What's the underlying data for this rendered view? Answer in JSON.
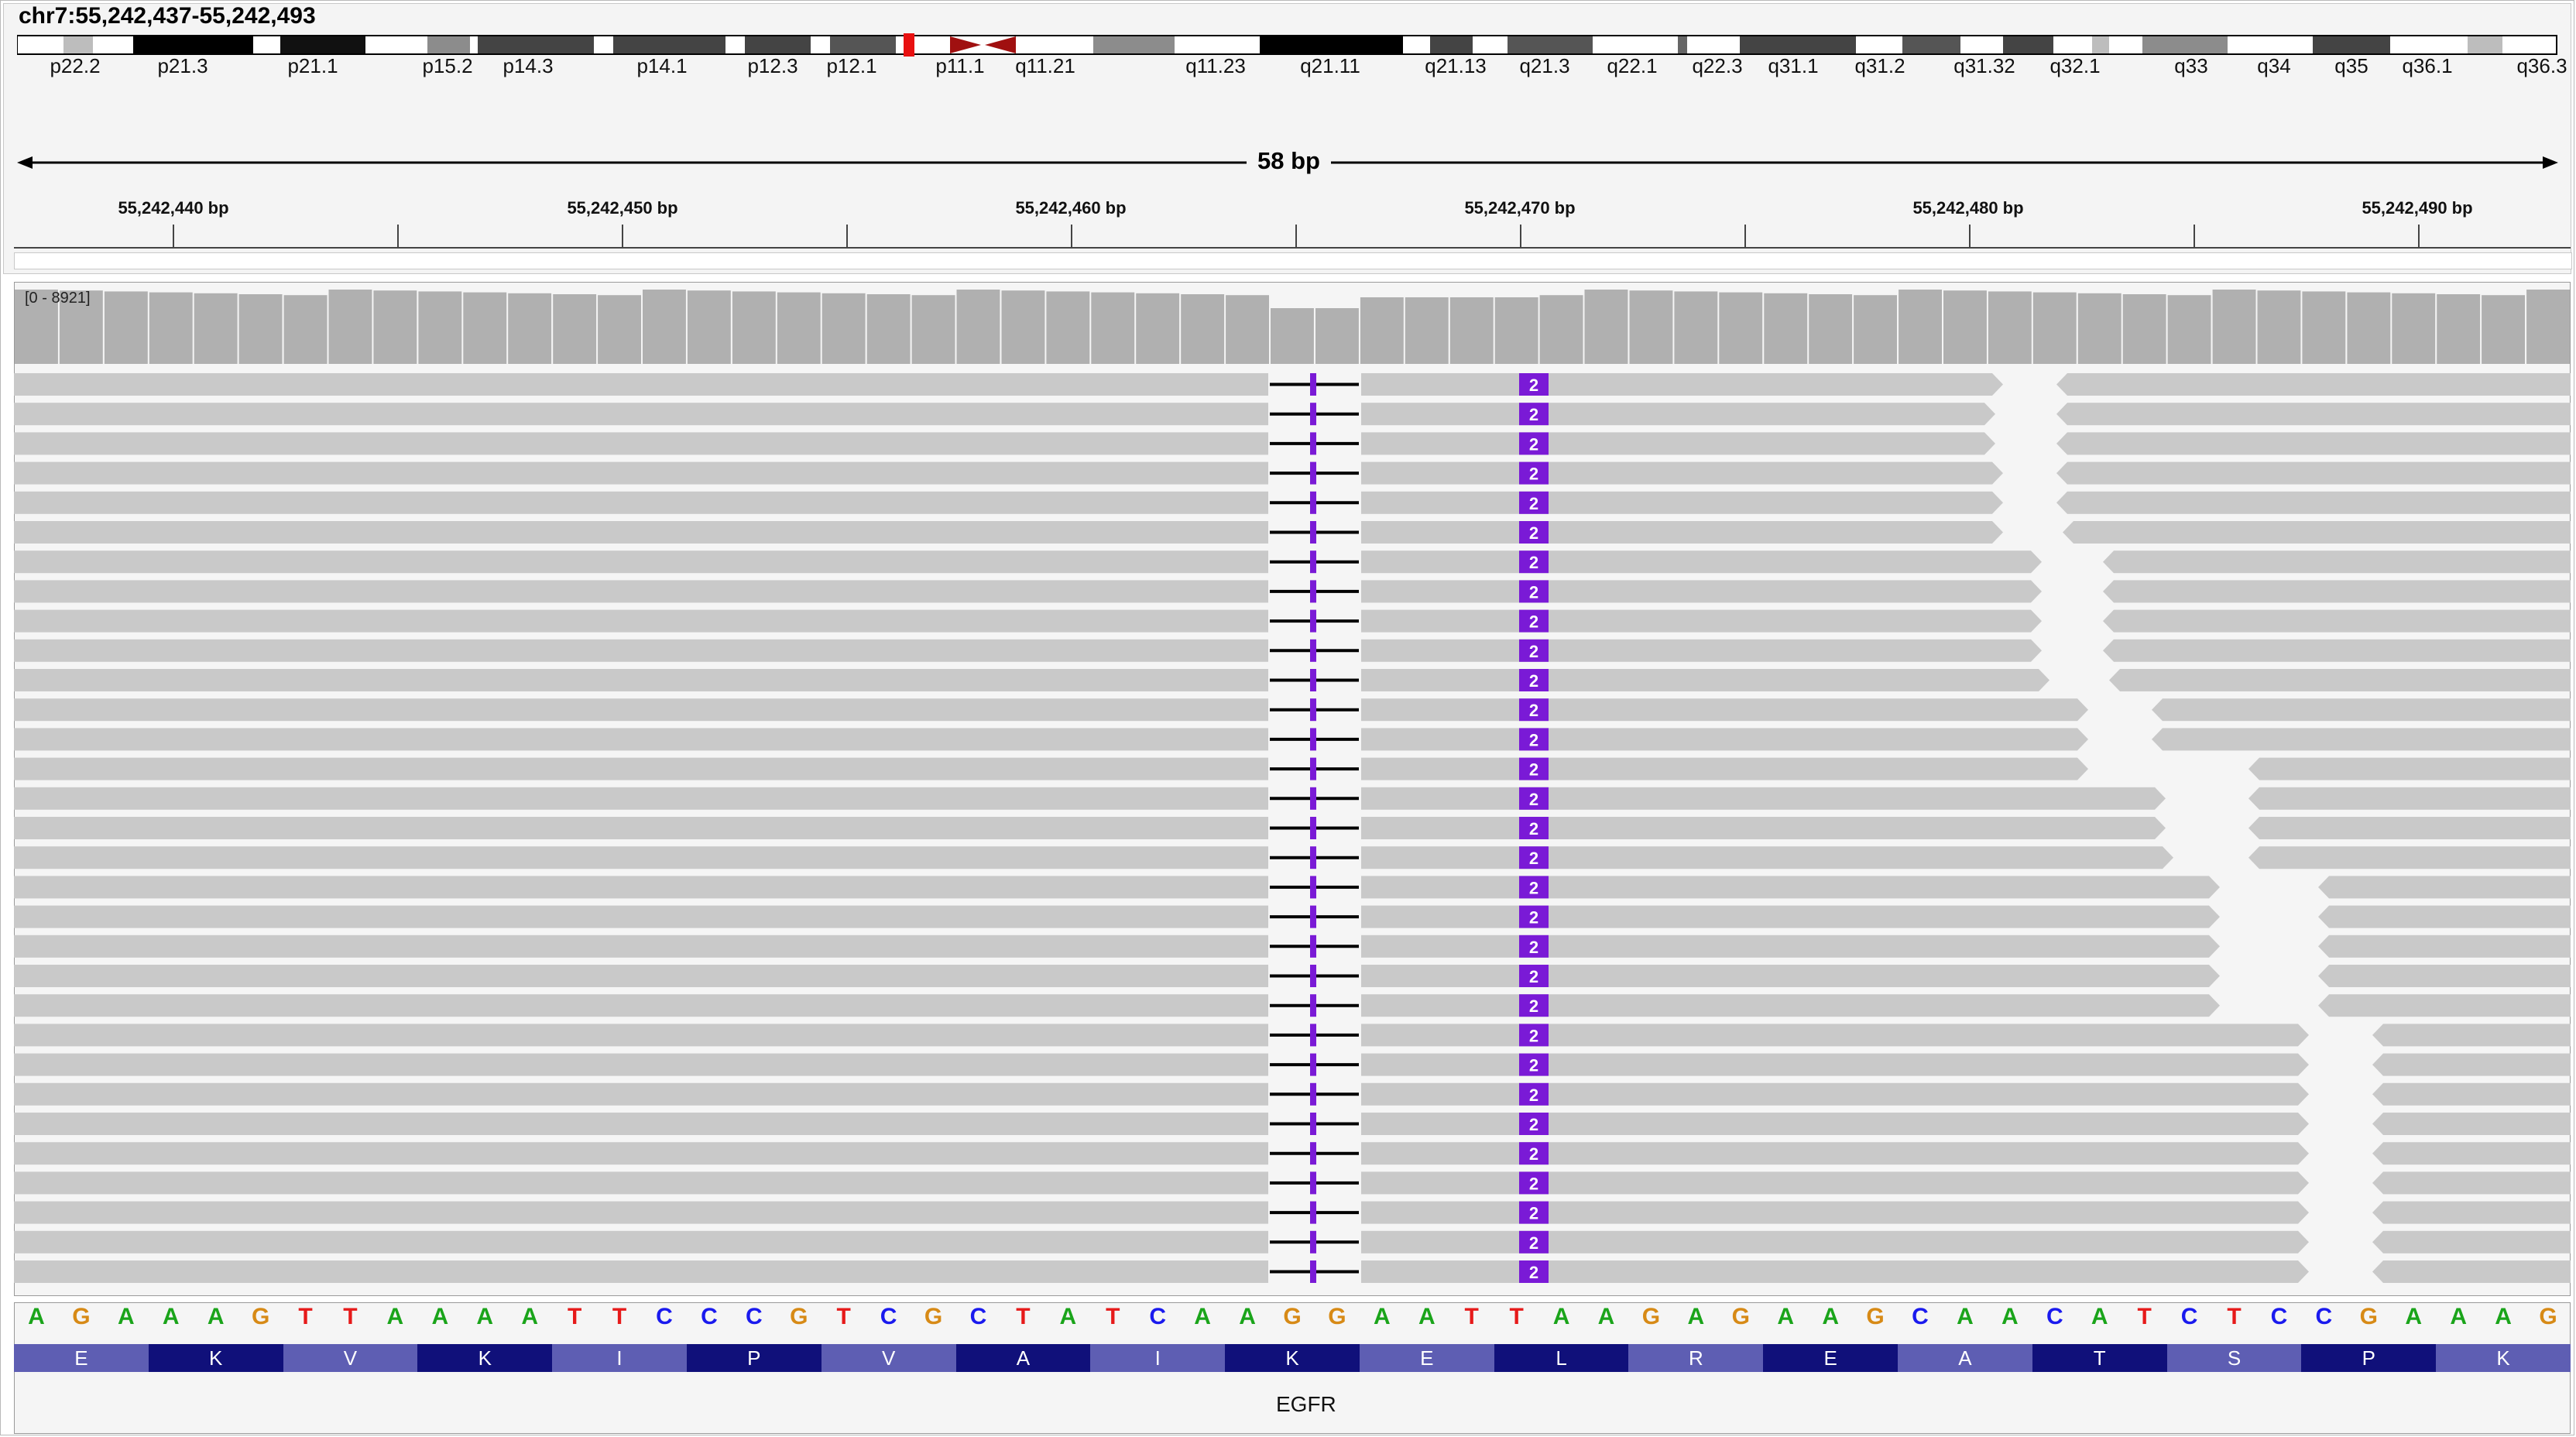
{
  "locus": "chr7:55,242,437-55,242,493",
  "span_label": "58 bp",
  "coverage_range": "[0 - 8921]",
  "gene_name": "EGFR",
  "ideogram_bands": [
    "p22.2",
    "p21.3",
    "p21.1",
    "p15.2",
    "p14.3",
    "p14.1",
    "p12.3",
    "p12.1",
    "p11.1",
    "q11.21",
    "q11.23",
    "q21.11",
    "q21.13",
    "q21.3",
    "q22.1",
    "q22.3",
    "q31.1",
    "q31.2",
    "q31.32",
    "q32.1",
    "q33",
    "q34",
    "q35",
    "q36.1",
    "q36.3"
  ],
  "ruler_labels": [
    "55,242,440 bp",
    "55,242,450 bp",
    "55,242,460 bp",
    "55,242,470 bp",
    "55,242,480 bp",
    "55,242,490 bp"
  ],
  "sequence": [
    "A",
    "G",
    "A",
    "A",
    "A",
    "G",
    "T",
    "T",
    "A",
    "A",
    "A",
    "A",
    "T",
    "T",
    "C",
    "C",
    "C",
    "G",
    "T",
    "C",
    "G",
    "C",
    "T",
    "A",
    "T",
    "C",
    "A",
    "A",
    "G",
    "G",
    "A",
    "A",
    "T",
    "T",
    "A",
    "A",
    "G",
    "A",
    "G",
    "A",
    "A",
    "G",
    "C",
    "A",
    "A",
    "C",
    "A",
    "T",
    "C",
    "T",
    "C",
    "C",
    "G",
    "A",
    "A",
    "A",
    "G"
  ],
  "amino_acids": [
    "E",
    "K",
    "V",
    "K",
    "I",
    "P",
    "V",
    "A",
    "I",
    "K",
    "E",
    "L",
    "R",
    "E",
    "A",
    "T",
    "S",
    "P",
    "K"
  ],
  "insertion_label": "2",
  "read_count": 31,
  "colors": {
    "A": "#1aa41a",
    "C": "#1a1aee",
    "G": "#d78a16",
    "T": "#e61a1a",
    "aa_dark": "#10107a",
    "aa_light": "#5e5eb3",
    "insertion": "#7a1ad6",
    "read": "#c9c9c9",
    "coverage": "#b0b0b0"
  }
}
